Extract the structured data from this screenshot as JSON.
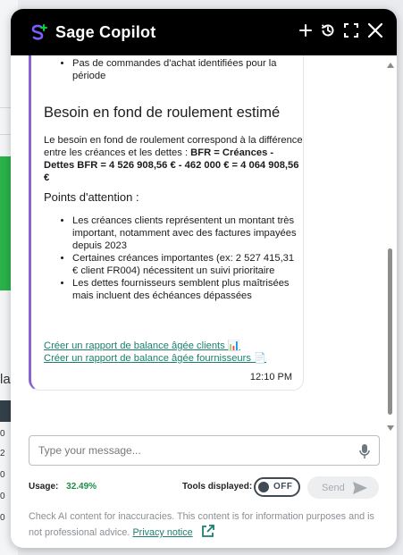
{
  "background": {
    "tail_text": "la",
    "row_digits": [
      "0",
      "2",
      "0",
      "0",
      "0"
    ]
  },
  "header": {
    "app_title": "Sage Copilot",
    "icons": [
      "sage-logo-icon",
      "plus-icon",
      "history-icon",
      "expand-icon",
      "close-icon"
    ]
  },
  "message": {
    "top_bullets": [
      "Pas de commandes d'achat identifiées pour la période"
    ],
    "heading": "Besoin en fond de roulement estimé",
    "paragraph": "Le besoin en fond de roulement correspond à la différence entre les créances et les dettes :",
    "formula": "BFR = Créances - Dettes BFR = 4 526 908,56 € - 462 000 € = 4 064 908,56 €",
    "attention_title": "Points d'attention :",
    "attention_points": [
      "Les créances clients représentent un montant très important, notamment avec des factures impayées depuis 2023",
      "Certaines créances importantes (ex: 2 527 415,31 € client FR004) nécessitent un suivi prioritaire",
      "Les dettes fournisseurs semblent plus maîtrisées mais incluent des échéances dépassées"
    ],
    "links": [
      "Créer un rapport de balance âgée clients 📊",
      "Créer un rapport de balance âgée fournisseurs 📄"
    ],
    "time": "12:10 PM"
  },
  "input": {
    "placeholder": "Type your message..."
  },
  "footer": {
    "usage_label": "Usage:",
    "usage_value": "32.49%",
    "tools_label": "Tools displayed:",
    "toggle_state": "OFF",
    "send_label": "Send",
    "disclaimer": "Check AI content for inaccuracies. This content is for information purposes and is not professional advice.",
    "privacy_link": "Privacy notice"
  },
  "colors": {
    "header_bg": "#000000",
    "accent_purple": "#8a63d2",
    "link_green": "#1b7f6e",
    "usage_green": "#1f8e4b"
  }
}
